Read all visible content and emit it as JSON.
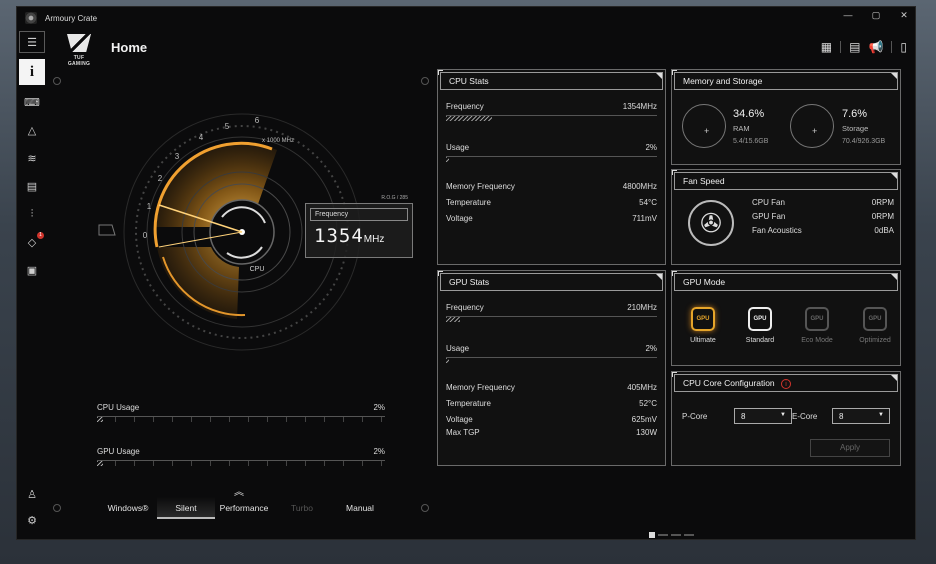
{
  "window": {
    "title": "Armoury Crate",
    "controls": [
      "—",
      "▢",
      "✕"
    ]
  },
  "header": {
    "title": "Home",
    "brand": "TUF GAMING"
  },
  "sidebar": {
    "active_glyph": "i",
    "badge": "1"
  },
  "gauge": {
    "scale": [
      "0",
      "1",
      "2",
      "3",
      "4",
      "5",
      "6"
    ],
    "unit_label": "x 1000 MHz",
    "center_label": "CPU",
    "box_tag": "R.O.G / 285",
    "box_label": "Frequency",
    "box_value": "1354",
    "box_unit": "MHz"
  },
  "usage": {
    "cpu": {
      "label": "CPU Usage",
      "value": "2%"
    },
    "gpu": {
      "label": "GPU Usage",
      "value": "2%"
    }
  },
  "modes": {
    "items": [
      "Windows®",
      "Silent",
      "Performance",
      "Turbo",
      "Manual"
    ],
    "selected": "Silent"
  },
  "cpu_stats": {
    "title": "CPU Stats",
    "frequency": {
      "label": "Frequency",
      "value": "1354MHz"
    },
    "usage": {
      "label": "Usage",
      "value": "2%"
    },
    "memory_frequency": {
      "label": "Memory Frequency",
      "value": "4800MHz"
    },
    "temperature": {
      "label": "Temperature",
      "value": "54°C"
    },
    "voltage": {
      "label": "Voltage",
      "value": "711mV"
    }
  },
  "gpu_stats": {
    "title": "GPU Stats",
    "frequency": {
      "label": "Frequency",
      "value": "210MHz"
    },
    "usage": {
      "label": "Usage",
      "value": "2%"
    },
    "memory_frequency": {
      "label": "Memory Frequency",
      "value": "405MHz"
    },
    "temperature": {
      "label": "Temperature",
      "value": "52°C"
    },
    "voltage": {
      "label": "Voltage",
      "value": "625mV"
    },
    "max_tgp": {
      "label": "Max TGP",
      "value": "130W"
    }
  },
  "memory_storage": {
    "title": "Memory and Storage",
    "ram": {
      "percent": "34.6%",
      "label": "RAM",
      "detail": "5.4/15.6GB"
    },
    "storage": {
      "percent": "7.6%",
      "label": "Storage",
      "detail": "70.4/926.3GB"
    }
  },
  "fan_speed": {
    "title": "Fan Speed",
    "cpu_fan": {
      "label": "CPU Fan",
      "value": "0RPM"
    },
    "gpu_fan": {
      "label": "GPU Fan",
      "value": "0RPM"
    },
    "acoustics": {
      "label": "Fan Acoustics",
      "value": "0dBA"
    }
  },
  "gpu_mode": {
    "title": "GPU Mode",
    "icon_text": "GPU",
    "options": [
      "Ultimate",
      "Standard",
      "Eco Mode",
      "Optimized"
    ],
    "selected": "Ultimate"
  },
  "core_config": {
    "title": "CPU Core Configuration",
    "p_core": {
      "label": "P-Core",
      "value": "8"
    },
    "e_core": {
      "label": "E-Core",
      "value": "8"
    },
    "apply_label": "Apply"
  }
}
